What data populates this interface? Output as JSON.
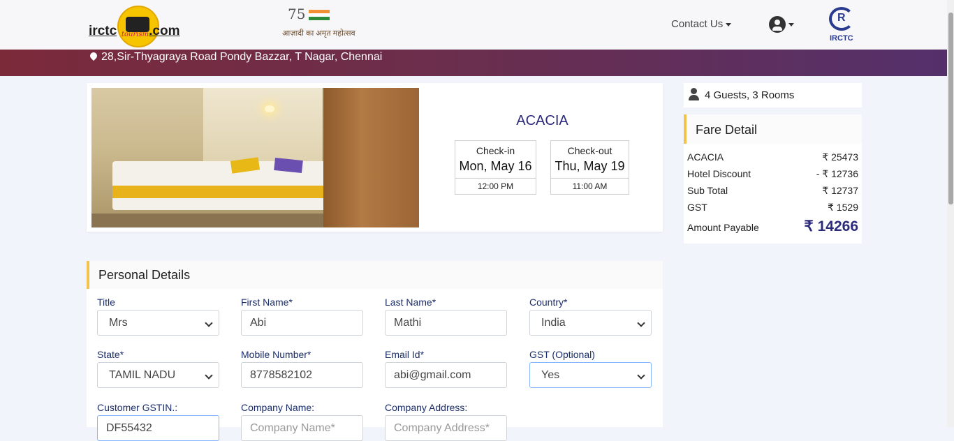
{
  "header": {
    "logo_text_left": "irctc",
    "logo_text_right": ".com",
    "logo_badge_text": "tourism",
    "azadi_number": "75",
    "azadi_text": "आज़ादी का अमृत महोत्सव",
    "contact_label": "Contact Us",
    "irctc_logo_text": "IRCTC",
    "irctc_logo_letter": "R"
  },
  "banner": {
    "address": "28,Sir-Thyagraya Road Pondy Bazzar, T Nagar, Chennai"
  },
  "hotel": {
    "name": "ACACIA",
    "checkin": {
      "label": "Check-in",
      "date": "Mon, May 16",
      "time": "12:00 PM"
    },
    "checkout": {
      "label": "Check-out",
      "date": "Thu, May 19",
      "time": "11:00 AM"
    }
  },
  "booking": {
    "guests_rooms": "4 Guests, 3 Rooms"
  },
  "fare": {
    "title": "Fare Detail",
    "rows": [
      {
        "label": "ACACIA",
        "value": "₹ 25473"
      },
      {
        "label": "Hotel Discount",
        "value": "- ₹ 12736"
      },
      {
        "label": "Sub Total",
        "value": "₹ 12737"
      },
      {
        "label": "GST",
        "value": "₹ 1529"
      },
      {
        "label": "Amount Payable",
        "value": "₹ 14266"
      }
    ]
  },
  "personal": {
    "title": "Personal Details",
    "fields": {
      "title": {
        "label": "Title",
        "value": "Mrs"
      },
      "first_name": {
        "label": "First Name*",
        "value": "Abi"
      },
      "last_name": {
        "label": "Last Name*",
        "value": "Mathi"
      },
      "country": {
        "label": "Country*",
        "value": "India"
      },
      "state": {
        "label": "State*",
        "value": "TAMIL NADU"
      },
      "mobile": {
        "label": "Mobile Number*",
        "value": "8778582102"
      },
      "email": {
        "label": "Email Id*",
        "value": "abi@gmail.com"
      },
      "gst": {
        "label": "GST (Optional)",
        "value": "Yes"
      },
      "gstin": {
        "label": "Customer GSTIN.:",
        "value": "DF55432"
      },
      "company_name": {
        "label": "Company Name:",
        "placeholder": "Company Name*"
      },
      "company_address": {
        "label": "Company Address:",
        "placeholder": "Company Address*"
      }
    }
  },
  "colors": {
    "accent_navy": "#2c2a7a",
    "accent_yellow": "#f2c24a",
    "banner_start": "#7b2a3a",
    "banner_end": "#54306b"
  }
}
